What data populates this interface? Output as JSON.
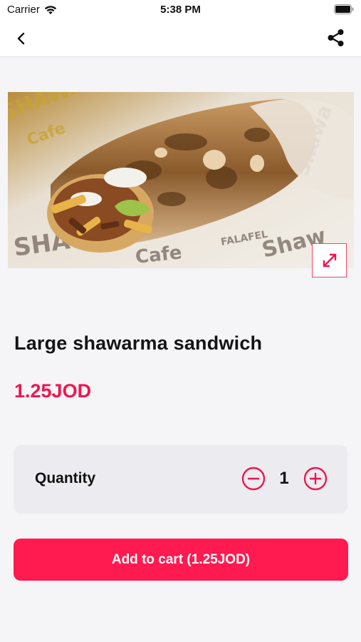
{
  "status_bar": {
    "carrier": "Carrier",
    "time": "5:38 PM",
    "icons": [
      "wifi-icon",
      "battery-icon"
    ]
  },
  "nav": {
    "back_icon": "chevron-left-icon",
    "share_icon": "share-icon"
  },
  "product": {
    "image": "shawarma-sandwich-photo",
    "expand_icon": "expand-arrows-icon",
    "title": "Large shawarma sandwich",
    "price": "1.25JOD"
  },
  "quantity": {
    "label": "Quantity",
    "value": "1",
    "minus_icon": "minus-circle-icon",
    "plus_icon": "plus-circle-icon"
  },
  "cart": {
    "button_label": "Add to cart (1.25JOD)"
  },
  "colors": {
    "accent": "#ff1a4f",
    "price": "#f0154f",
    "background": "#f5f5f7",
    "card": "#ececf0"
  }
}
